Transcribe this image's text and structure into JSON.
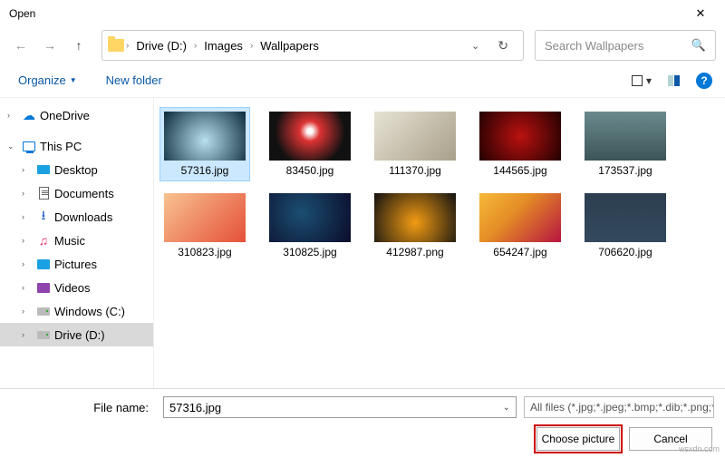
{
  "window": {
    "title": "Open"
  },
  "breadcrumb": {
    "items": [
      "Drive (D:)",
      "Images",
      "Wallpapers"
    ]
  },
  "search": {
    "placeholder": "Search Wallpapers"
  },
  "toolbar": {
    "organize": "Organize",
    "newfolder": "New folder"
  },
  "sidebar": {
    "onedrive": "OneDrive",
    "thispc": "This PC",
    "items": [
      {
        "label": "Desktop"
      },
      {
        "label": "Documents"
      },
      {
        "label": "Downloads"
      },
      {
        "label": "Music"
      },
      {
        "label": "Pictures"
      },
      {
        "label": "Videos"
      },
      {
        "label": "Windows (C:)"
      },
      {
        "label": "Drive (D:)"
      }
    ]
  },
  "files": [
    {
      "name": "57316.jpg",
      "selected": true,
      "thumb": "t0"
    },
    {
      "name": "83450.jpg",
      "selected": false,
      "thumb": "t1"
    },
    {
      "name": "111370.jpg",
      "selected": false,
      "thumb": "t2"
    },
    {
      "name": "144565.jpg",
      "selected": false,
      "thumb": "t3"
    },
    {
      "name": "173537.jpg",
      "selected": false,
      "thumb": "t4"
    },
    {
      "name": "310823.jpg",
      "selected": false,
      "thumb": "t5"
    },
    {
      "name": "310825.jpg",
      "selected": false,
      "thumb": "t6"
    },
    {
      "name": "412987.png",
      "selected": false,
      "thumb": "t7"
    },
    {
      "name": "654247.jpg",
      "selected": false,
      "thumb": "t8"
    },
    {
      "name": "706620.jpg",
      "selected": false,
      "thumb": "t9"
    }
  ],
  "footer": {
    "filename_label": "File name:",
    "filename_value": "57316.jpg",
    "filter": "All files (*.jpg;*.jpeg;*.bmp;*.dib;*.png;*.jfif;*",
    "primary": "Choose picture",
    "cancel": "Cancel"
  },
  "watermark": "wsxdn.com"
}
